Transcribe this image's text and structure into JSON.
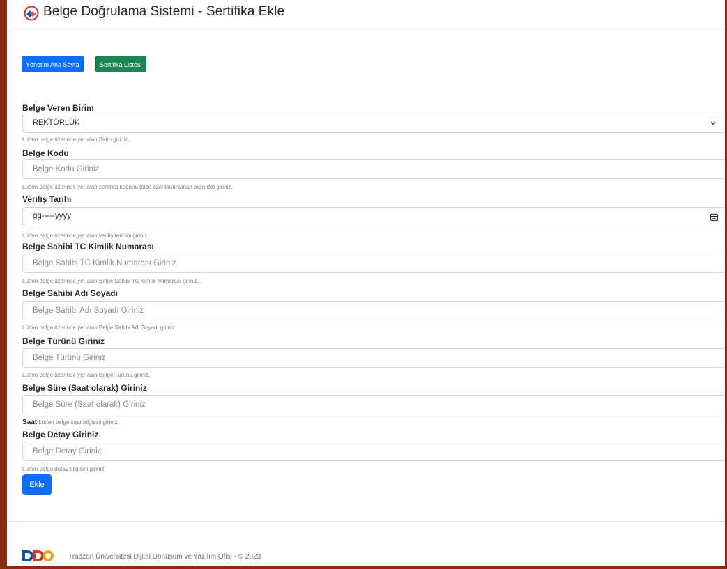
{
  "header": {
    "title": "Belge Doğrulama Sistemi - Sertifika Ekle",
    "logo_icon": "badge-check-icon"
  },
  "nav": {
    "home_label": "Yönetim Ana Sayfa",
    "list_label": "Sertifika Listesi"
  },
  "form": {
    "unit": {
      "label": "Belge Veren Birim",
      "value": "REKTÖRLÜK",
      "help": "Lütfen belge üzerinde yer alan Birim giriniz."
    },
    "code": {
      "label": "Belge Kodu",
      "placeholder": "Belge Kodu Giriniz",
      "help": "Lütfen belge üzerinde yer alan sertifika kodunu (size özel tanımlanan biçimde) giriniz."
    },
    "date": {
      "label": "Veriliş Tarihi",
      "value": "gg-----yyyy",
      "help": "Lütfen belge üzerinde yer alan veriliş tarihini giriniz."
    },
    "tc": {
      "label": "Belge Sahibi TC Kimlik Numarası",
      "placeholder": "Belge Sahibi TC Kimlik Numarası Giriniz",
      "help": "Lütfen belge üzerinde yer alan Belge Sahibi TC Kimlik Numarası giriniz."
    },
    "name": {
      "label": "Belge Sahibi Adı Soyadı",
      "placeholder": "Belge Sahibi Adı Soyadı Giriniz",
      "help": "Lütfen belge üzerinde yer alan Belge Sahibi Adı Soyadı giriniz."
    },
    "type": {
      "label": "Belge Türünü Giriniz",
      "placeholder": "Belge Türünü Giriniz",
      "help": "Lütfen belge üzerinde yer alan Belge Türünü giriniz."
    },
    "duration": {
      "label": "Belge Süre (Saat olarak) Giriniz",
      "placeholder": "Belge Süre (Saat olarak) Giriniz",
      "unit": "Saat",
      "help": "Lütfen belge saat bilgisini giriniz."
    },
    "detail": {
      "label": "Belge Detay Giriniz",
      "placeholder": "Belge Detay Giriniz",
      "help": "Lütfen belge detay bilgisini giriniz."
    },
    "submit_label": "Ekle"
  },
  "footer": {
    "logo_text": "DDO",
    "text": "Trabzon Üniversitesi Dijital Dönüşüm ve Yazılım Ofisi - © 2023"
  },
  "colors": {
    "primary": "#0d6efd",
    "success": "#198754",
    "frame": "#8b2a12"
  }
}
